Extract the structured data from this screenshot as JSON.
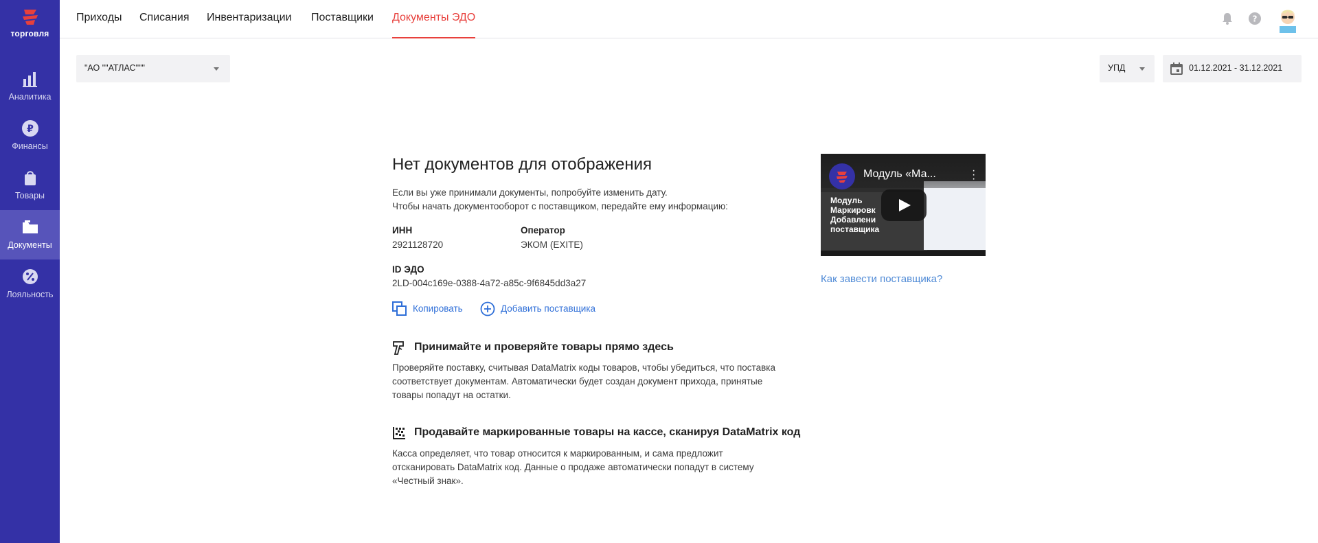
{
  "sidebar": {
    "logo_text": "торговля",
    "items": [
      {
        "label": "Аналитика",
        "icon": "bar-chart-icon",
        "active": false
      },
      {
        "label": "Финансы",
        "icon": "ruble-icon",
        "active": false
      },
      {
        "label": "Товары",
        "icon": "bag-icon",
        "active": false
      },
      {
        "label": "Документы",
        "icon": "folder-icon",
        "active": true
      },
      {
        "label": "Лояльность",
        "icon": "discount-badge-icon",
        "active": false
      }
    ]
  },
  "topbar": {
    "tabs": [
      {
        "label": "Приходы",
        "active": false
      },
      {
        "label": "Списания",
        "active": false
      },
      {
        "label": "Инвентаризации",
        "active": false
      },
      {
        "label": "Поставщики",
        "active": false
      },
      {
        "label": "Документы ЭДО",
        "active": true
      }
    ],
    "icons": [
      "bell-icon",
      "help-icon",
      "avatar"
    ]
  },
  "filters": {
    "organization": "\"АО \"\"АТЛАС\"\"\"",
    "doc_type": "УПД",
    "date_range": "01.12.2021 - 31.12.2021"
  },
  "empty_state": {
    "title": "Нет документов для отображения",
    "line1": "Если вы уже принимали документы, попробуйте изменить дату.",
    "line2": "Чтобы начать документооборот с поставщиком, передайте ему информацию:",
    "inn_label": "ИНН",
    "inn_value": "2921128720",
    "operator_label": "Оператор",
    "operator_value": "ЭКОМ (EXITE)",
    "edo_label": "ID ЭДО",
    "edo_value": "2LD-004c169e-0388-4a72-a85c-9f6845dd3a27",
    "copy_label": "Копировать",
    "add_supplier_label": "Добавить поставщика"
  },
  "section1": {
    "title": "Принимайте и проверяйте товары прямо здесь",
    "lines": [
      "Проверяйте поставку, считывая DataMatrix коды товаров, чтобы убедиться, что поставка",
      "соответствует документам. Автоматически будет создан документ прихода, принятые",
      "товары попадут на остатки."
    ]
  },
  "section2": {
    "title": "Продавайте маркированные товары на кассе, сканируя DataMatrix код",
    "lines": [
      "Касса определяет, что товар относится к маркированным, и сама предложит",
      "отсканировать DataMatrix код. Данные о продаже автоматически попадут в систему",
      "«Честный знак»."
    ]
  },
  "video": {
    "title": "Модуль «Ма...",
    "caption_lines": [
      "Модуль",
      "Маркировк",
      "Добавлени",
      "поставщика"
    ]
  },
  "help_link": "Как завести поставщика?",
  "colors": {
    "sidebar": "#3431a6",
    "sidebar_active": "#5754ba",
    "accent_tab": "#e8403c",
    "link": "#2f6fd8"
  }
}
